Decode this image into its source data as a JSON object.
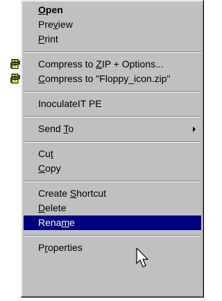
{
  "menu": {
    "items": [
      {
        "label": "Open",
        "mnemonic_index": 0
      },
      {
        "label": "Preview",
        "mnemonic_index": 3
      },
      {
        "label": "Print",
        "mnemonic_index": 0
      },
      {
        "label": "Compress to ZIP + Options...",
        "mnemonic_index": 12,
        "icon": "zip-archive-icon"
      },
      {
        "label": "Compress to \"Floppy_icon.zip\"",
        "mnemonic_index": 0,
        "icon": "zip-archive-icon"
      },
      {
        "label": "InoculateIT PE",
        "mnemonic_index": -1
      },
      {
        "label": "Send To",
        "mnemonic_index": 5,
        "submenu_icon": "submenu-arrow-icon"
      },
      {
        "label": "Cut",
        "mnemonic_index": 2
      },
      {
        "label": "Copy",
        "mnemonic_index": 0
      },
      {
        "label": "Create Shortcut",
        "mnemonic_index": 7
      },
      {
        "label": "Delete",
        "mnemonic_index": 0
      },
      {
        "label": "Rename",
        "mnemonic_index": 4,
        "selected": true
      },
      {
        "label": "Properties",
        "mnemonic_index": 1
      }
    ]
  },
  "colors": {
    "menu_background": "#c0c0c0",
    "highlight_background": "#000080",
    "highlight_text": "#ffffff"
  },
  "cursor": "arrow-pointer-icon"
}
